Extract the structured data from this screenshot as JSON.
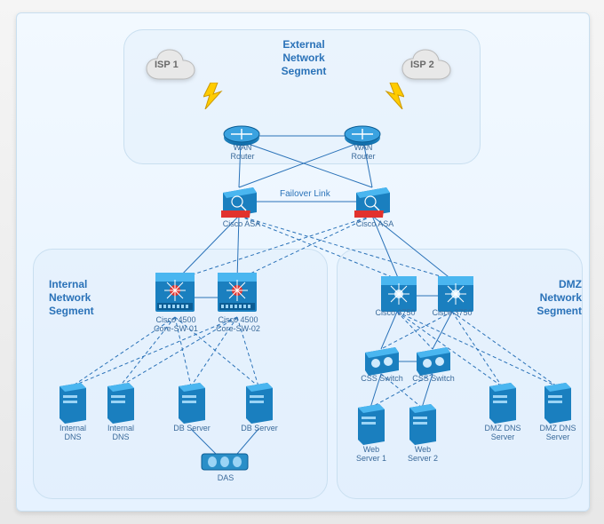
{
  "segments": {
    "external": "External\nNetwork Segment",
    "internal": "Internal\nNetwork\nSegment",
    "dmz": "DMZ\nNetwork\nSegment"
  },
  "labels": {
    "isp1": "ISP 1",
    "isp2": "ISP 2",
    "wan_router_1": "WAN\nRouter",
    "wan_router_2": "WAN\nRouter",
    "failover_link": "Failover Link",
    "cisco_asa_1": "Cisco ASA",
    "cisco_asa_2": "Cisco ASA",
    "core_sw_1": "Cisco 4500\nCore-SW-01",
    "core_sw_2": "Cisco 4500\nCore-SW-02",
    "cisco_3750_1": "Cisco 3750",
    "cisco_3750_2": "Cisco 3750",
    "css_sw_1": "CSS Switch",
    "css_sw_2": "CSS Switch",
    "dmz_dns_1": "DMZ DNS\nServer",
    "dmz_dns_2": "DMZ DNS\nServer",
    "web_srv_1": "Web\nServer 1",
    "web_srv_2": "Web\nServer 2",
    "int_dns_1": "Internal\nDNS",
    "int_dns_2": "Internal\nDNS",
    "db_srv_1": "DB Server",
    "db_srv_2": "DB Server",
    "das": "DAS"
  },
  "colors": {
    "device_blue": "#1a7fbf",
    "firewall_red": "#e1322d",
    "line_solid": "#2a72b8",
    "line_dash": "#2a72b8",
    "cloud": "#d9d9d9"
  }
}
